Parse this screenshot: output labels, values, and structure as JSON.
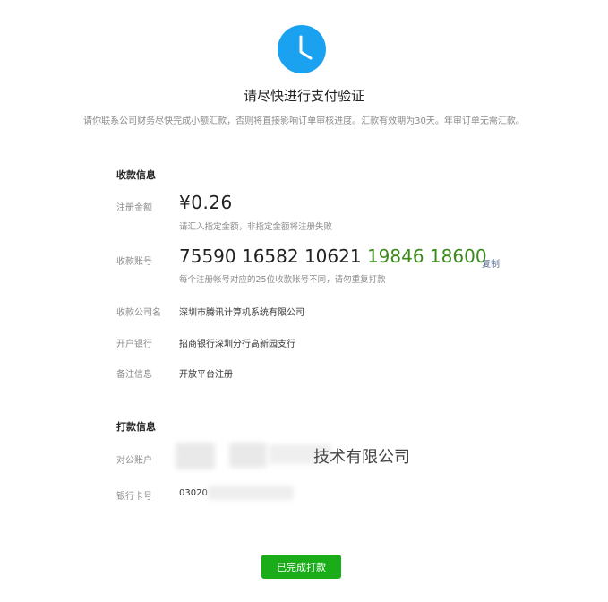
{
  "header": {
    "icon": "clock-icon",
    "title": "请尽快进行支付验证",
    "notice": "请你联系公司财务尽快完成小额汇款，否则将直接影响订单审核进度。汇款有效期为30天。年审订单无需汇款。"
  },
  "receiving": {
    "section_title": "收款信息",
    "amount_label": "注册金额",
    "amount_value": "¥0.26",
    "amount_hint": "请汇入指定金额，非指定金额将注册失败",
    "account_label": "收款账号",
    "account_part1": "75590 16582 10621",
    "account_part2": "19846 18600",
    "copy_label": "复制",
    "account_hint": "每个注册帐号对应的25位收款账号不同，请勿重复打款",
    "company_label": "收款公司名",
    "company_value": "深圳市腾讯计算机系统有限公司",
    "bank_label": "开户银行",
    "bank_value": "招商银行深圳分行高新园支行",
    "remark_label": "备注信息",
    "remark_value": "开放平台注册"
  },
  "paying": {
    "section_title": "打款信息",
    "corp_account_label": "对公账户",
    "corp_account_visible": "技术有限公司",
    "card_label": "银行卡号",
    "card_visible": "03020"
  },
  "actions": {
    "done_label": "已完成打款"
  },
  "colors": {
    "accent_blue": "#1aa2f0",
    "green_button": "#1aad19",
    "green_digits": "#3c8a1c",
    "link_blue": "#576b95"
  }
}
